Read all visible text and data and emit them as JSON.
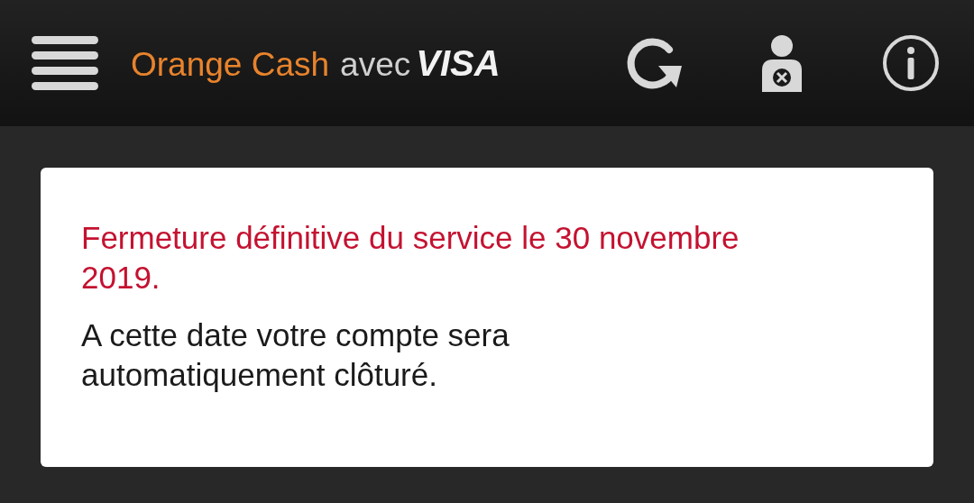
{
  "header": {
    "brand": "Orange Cash",
    "connector": "avec",
    "partner": "VISA"
  },
  "notice": {
    "title": "Fermeture définitive du service le 30 novembre 2019.",
    "body": "A cette date votre compte sera automatiquement clôturé."
  }
}
